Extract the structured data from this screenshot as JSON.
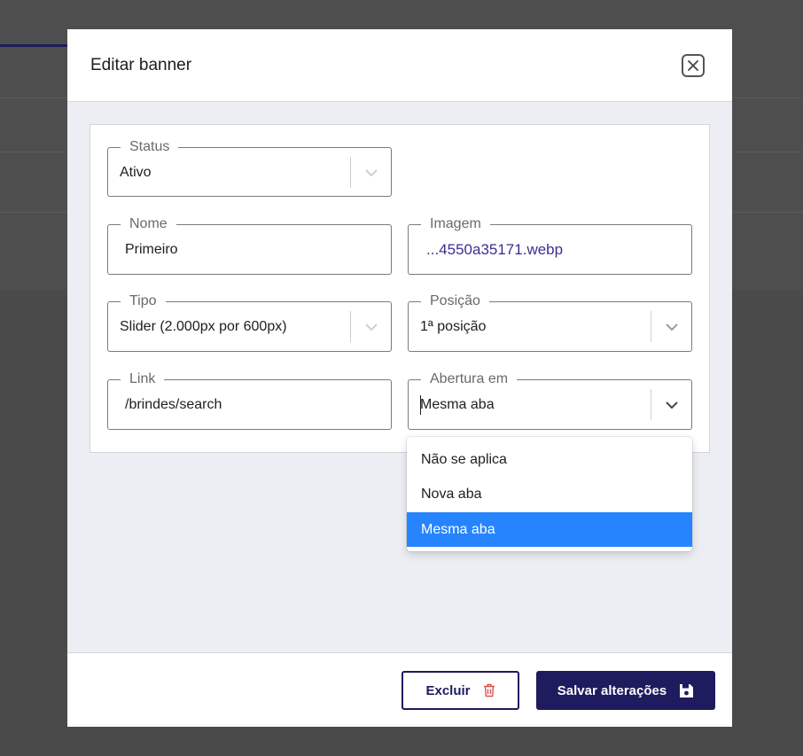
{
  "modal": {
    "title": "Editar banner",
    "close_icon": "close-icon"
  },
  "form": {
    "status": {
      "label": "Status",
      "value": "Ativo"
    },
    "nome": {
      "label": "Nome",
      "value": "Primeiro"
    },
    "imagem": {
      "label": "Imagem",
      "value": "...4550a35171.webp",
      "color": "#3b2f8f"
    },
    "tipo": {
      "label": "Tipo",
      "value": "Slider (2.000px por 600px)"
    },
    "posicao": {
      "label": "Posição",
      "value": "1ª posição"
    },
    "link": {
      "label": "Link",
      "value": "/brindes/search"
    },
    "abertura": {
      "label": "Abertura em",
      "value": "Mesma aba"
    }
  },
  "dropdown": {
    "options": [
      "Não se aplica",
      "Nova aba",
      "Mesma aba"
    ],
    "selected": "Mesma aba",
    "highlight_color": "#2684ff"
  },
  "footer": {
    "delete_label": "Excluir",
    "delete_icon": "trash-icon",
    "save_label": "Salvar alterações",
    "save_icon": "floppy-disk-icon",
    "primary_color": "#1e1b5e"
  }
}
